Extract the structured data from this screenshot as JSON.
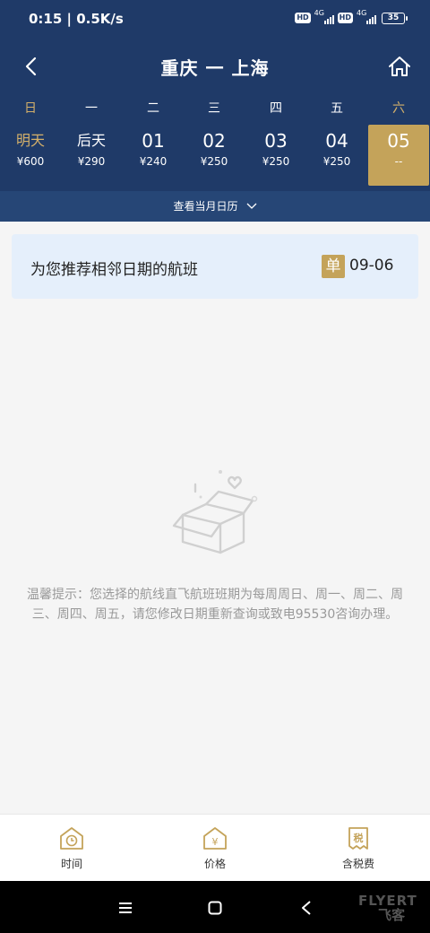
{
  "status_bar": {
    "time": "0:15 | 0.5K/s",
    "hd1": "HD",
    "net1": "4G",
    "hd2": "HD",
    "net2": "4G",
    "battery": "35"
  },
  "header": {
    "title": "重庆 一 上海"
  },
  "weekdays": [
    "日",
    "一",
    "二",
    "三",
    "四",
    "五",
    "六"
  ],
  "dates": [
    {
      "label": "明天",
      "price": "¥600"
    },
    {
      "label": "后天",
      "price": "¥290"
    },
    {
      "label": "01",
      "price": "¥240"
    },
    {
      "label": "02",
      "price": "¥250"
    },
    {
      "label": "03",
      "price": "¥250"
    },
    {
      "label": "04",
      "price": "¥250"
    },
    {
      "label": "05",
      "price": "--"
    }
  ],
  "calendar_link": "查看当月日历",
  "recommend": {
    "text": "为您推荐相邻日期的航班",
    "badge": "单",
    "date": "09-06"
  },
  "tip": "温馨提示：您选择的航线直飞航班班期为每周周日、周一、周二、周三、周四、周五，请您修改日期重新查询或致电95530咨询办理。",
  "tabs": [
    {
      "label": "时间",
      "icon": "clock-house-icon"
    },
    {
      "label": "价格",
      "icon": "yuan-house-icon"
    },
    {
      "label": "含税费",
      "icon": "tax-receipt-icon"
    }
  ],
  "tax_icon_text": "税",
  "yuan_icon_text": "¥",
  "watermark": {
    "line1": "FLYERT",
    "line2": "飞客"
  },
  "colors": {
    "header": "#1f3a68",
    "gold": "#c4a35a",
    "gold_text": "#d4b06a",
    "card": "#e5effb"
  }
}
